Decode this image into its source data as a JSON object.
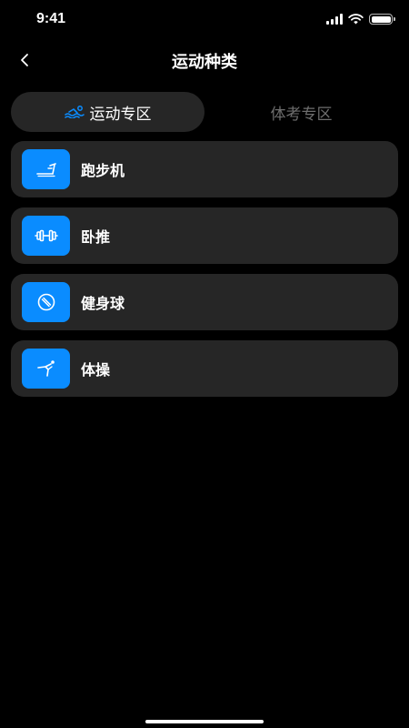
{
  "status_bar": {
    "time": "9:41"
  },
  "nav": {
    "title": "运动种类",
    "back_icon": "chevron-left-icon"
  },
  "tabs": [
    {
      "label": "运动专区",
      "active": true,
      "icon": "swimmer-icon"
    },
    {
      "label": "体考专区",
      "active": false
    }
  ],
  "sports": [
    {
      "label": "跑步机",
      "icon": "treadmill-icon"
    },
    {
      "label": "卧推",
      "icon": "dumbbell-icon"
    },
    {
      "label": "健身球",
      "icon": "fitness-ball-icon"
    },
    {
      "label": "体操",
      "icon": "gymnastics-icon"
    }
  ],
  "colors": {
    "background": "#000000",
    "card": "#262626",
    "accent": "#0a8cff",
    "inactive_text": "#6e6e6e"
  }
}
